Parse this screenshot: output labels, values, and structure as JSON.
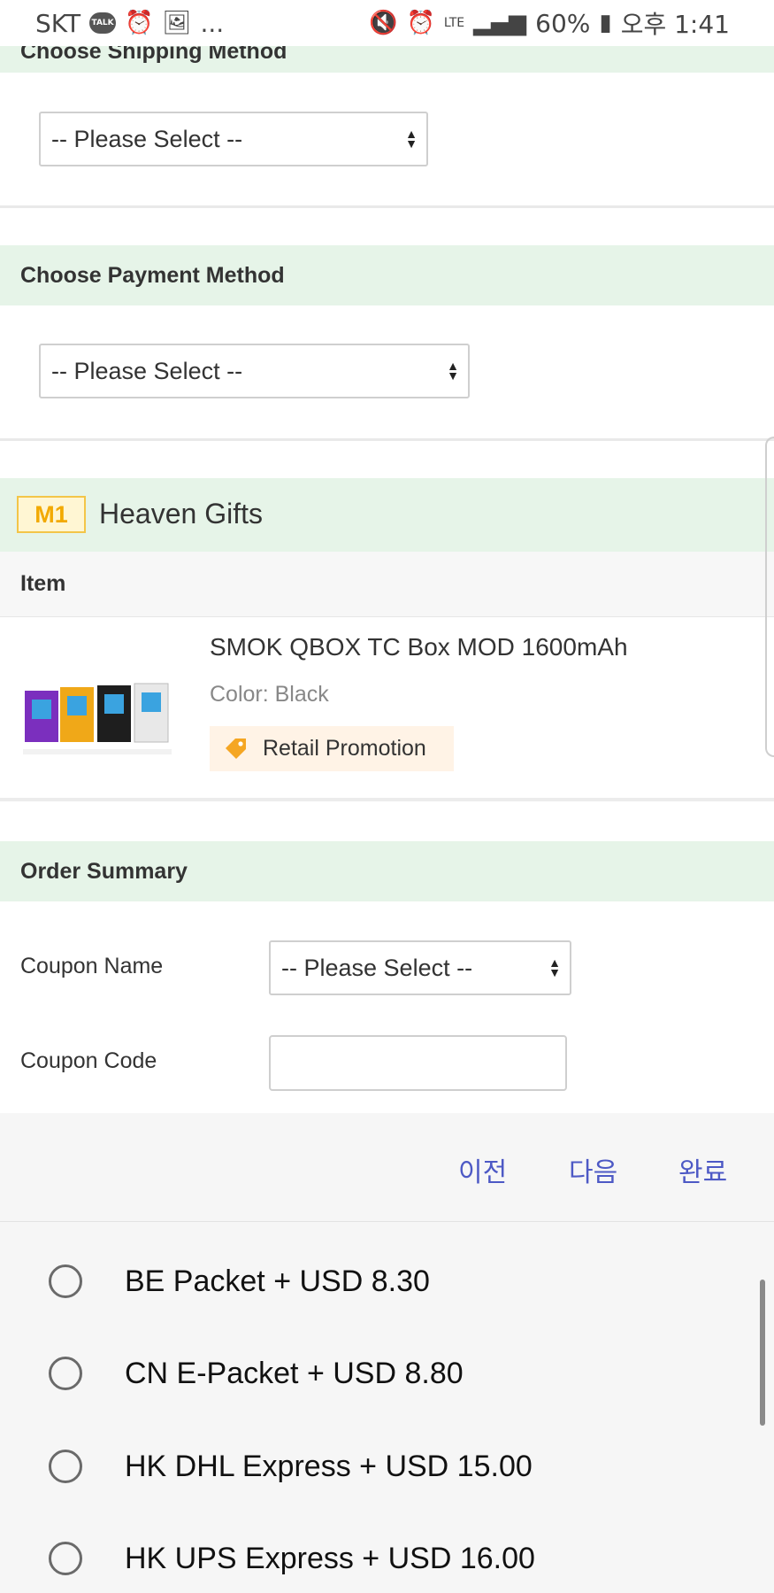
{
  "status_bar": {
    "carrier": "SKT",
    "talk_badge": "TALK",
    "ellipsis": "...",
    "network": "LTE",
    "battery": "60%",
    "time": "오후 1:41"
  },
  "shipping": {
    "header": "Choose Shipping Method",
    "select_value": "-- Please Select --"
  },
  "payment": {
    "header": "Choose Payment Method",
    "select_value": "-- Please Select --"
  },
  "store": {
    "badge": "M1",
    "name": "Heaven Gifts"
  },
  "items": {
    "column_header": "Item",
    "list": [
      {
        "title": "SMOK QBOX TC Box MOD 1600mAh",
        "color": "Color: Black",
        "promotion": "Retail Promotion"
      }
    ]
  },
  "order_summary": {
    "header": "Order Summary",
    "coupon_name_label": "Coupon Name",
    "coupon_name_value": "-- Please Select --",
    "coupon_code_label": "Coupon Code",
    "coupon_code_value": ""
  },
  "picker": {
    "prev": "이전",
    "next": "다음",
    "done": "완료",
    "options": [
      "BE Packet + USD 8.30",
      "CN E-Packet + USD 8.80",
      "HK DHL Express + USD 15.00",
      "HK UPS Express + USD 16.00"
    ]
  },
  "colors": {
    "section_bg": "#e6f4e8",
    "accent_nav": "#4d59c5",
    "badge_yellow": "#f2a900",
    "promo_orange": "#f5a623"
  }
}
